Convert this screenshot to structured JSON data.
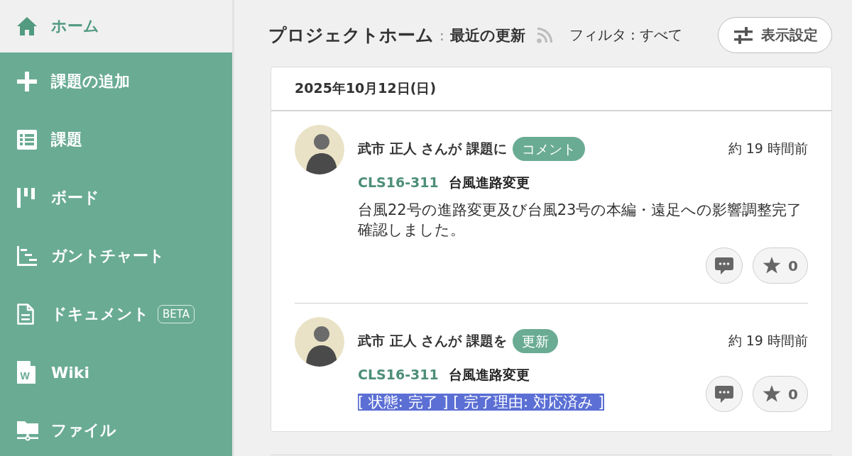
{
  "sidebar": {
    "items": [
      {
        "label": "ホーム",
        "selected": true
      },
      {
        "label": "課題の追加",
        "selected": false
      },
      {
        "label": "課題",
        "selected": false
      },
      {
        "label": "ボード",
        "selected": false
      },
      {
        "label": "ガントチャート",
        "selected": false
      },
      {
        "label": "ドキュメント",
        "selected": false,
        "badge": "BETA"
      },
      {
        "label": "Wiki",
        "selected": false,
        "icon_letter": "W"
      },
      {
        "label": "ファイル",
        "selected": false
      }
    ]
  },
  "header": {
    "title": "プロジェクトホーム",
    "separator": ":",
    "subtitle": "最近の更新",
    "filter": "フィルタ : すべて",
    "settings_button": "表示設定"
  },
  "activity": {
    "date": "2025年10月12日(日)",
    "entries": [
      {
        "actor": "武市 正人 さんが 課題に",
        "action": "コメント",
        "time": "約 19 時間前",
        "issue_key": "CLS16-311",
        "issue_title": "台風進路変更",
        "body": {
          "text": "台風22号の進路変更及び台風23号の本編・遠足への影響調整完了確認しました。",
          "selected": false
        },
        "star_count": "0"
      },
      {
        "actor": "武市 正人 さんが 課題を",
        "action": "更新",
        "time": "約 19 時間前",
        "issue_key": "CLS16-311",
        "issue_title": "台風進路変更",
        "body": {
          "text": "[ 状態: 完了 ] [ 完了理由: 対応済み ]",
          "selected": true
        },
        "star_count": "0"
      }
    ]
  }
}
